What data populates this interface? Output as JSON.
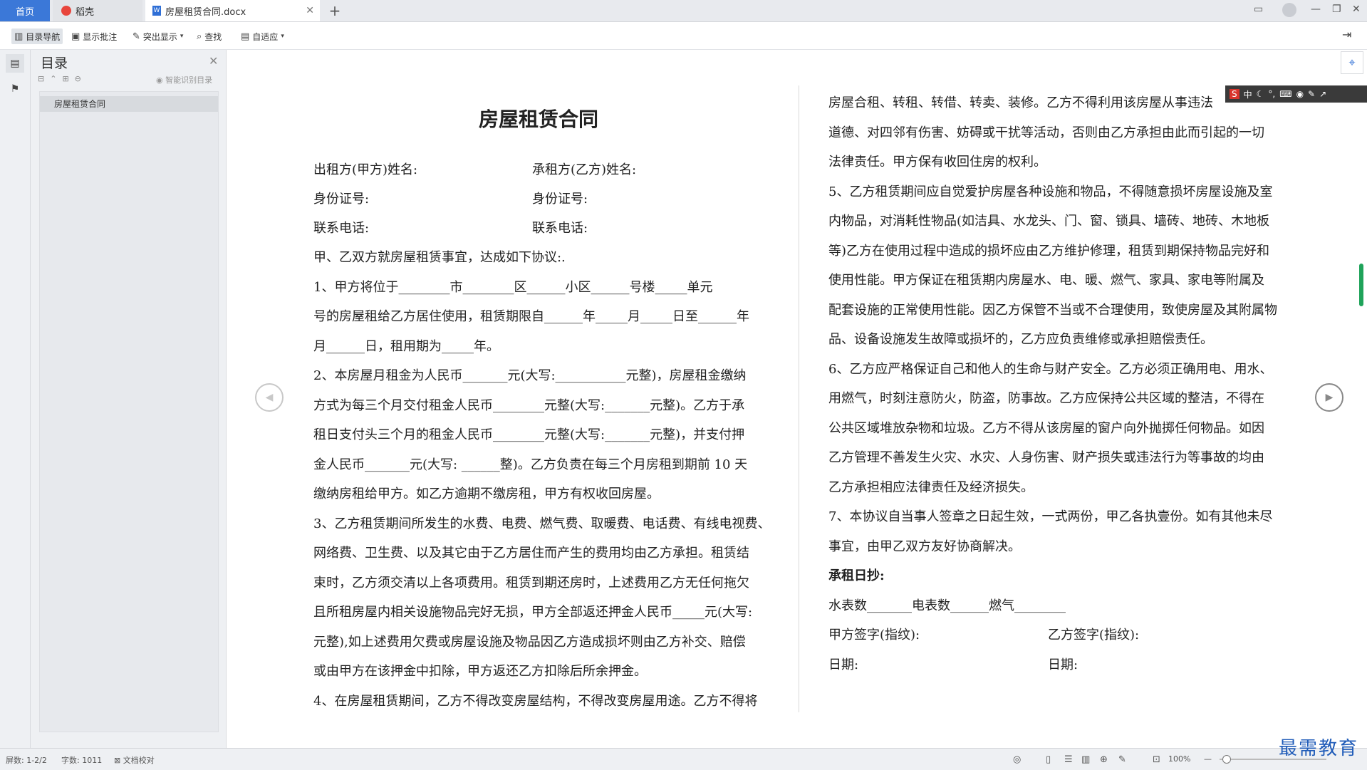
{
  "tabs": {
    "home": "首页",
    "daoke": "稻壳",
    "doc": "房屋租赁合同.docx"
  },
  "toolbar": {
    "toc_nav": "目录导航",
    "show_comments": "显示批注",
    "highlight": "突出显示",
    "find": "查找",
    "fit": "自适应"
  },
  "nav": {
    "title": "目录",
    "smart_toc": "智能识别目录",
    "items": [
      "房屋租赁合同"
    ]
  },
  "document": {
    "title": "房屋租赁合同",
    "left_lines": [
      "出租方(甲方)姓名:",
      "承租方(乙方)姓名:",
      "身份证号:",
      "身份证号:",
      "联系电话:",
      "联系电话:",
      "甲、乙双方就房屋租赁事宜，达成如下协议:.",
      "1、甲方将位于________市________区______小区______号楼_____单元",
      "号的房屋租给乙方居住使用，租赁期限自______年_____月_____日至______年",
      "月______日，租用期为_____年。",
      "2、本房屋月租金为人民币_______元(大写:___________元整)，房屋租金缴纳",
      "方式为每三个月交付租金人民币________元整(大写:_______元整)。乙方于承",
      "租日支付头三个月的租金人民币________元整(大写:_______元整)，并支付押",
      "金人民币_______元(大写: ______整)。乙方负责在每三个月房租到期前 10 天",
      "缴纳房租给甲方。如乙方逾期不缴房租，甲方有权收回房屋。",
      "3、乙方租赁期间所发生的水费、电费、燃气费、取暖费、电话费、有线电视费、",
      "网络费、卫生费、以及其它由于乙方居住而产生的费用均由乙方承担。租赁结",
      "束时，乙方须交清以上各项费用。租赁到期还房时，上述费用乙方无任何拖欠",
      "且所租房屋内相关设施物品完好无损，甲方全部返还押金人民币_____元(大写:",
      "元整),如上述费用欠费或房屋设施及物品因乙方造成损坏则由乙方补交、赔偿",
      "或由甲方在该押金中扣除，甲方返还乙方扣除后所余押金。",
      "4、在房屋租赁期间，乙方不得改变房屋结构，不得改变房屋用途。乙方不得将"
    ],
    "right_lines": [
      "房屋合租、转租、转借、转卖、装修。乙方不得利用该房屋从事违法",
      "道德、对四邻有伤害、妨碍或干扰等活动，否则由乙方承担由此而引起的一切",
      "法律责任。甲方保有收回住房的权利。",
      "5、乙方租赁期间应自觉爱护房屋各种设施和物品，不得随意损坏房屋设施及室",
      "内物品，对消耗性物品(如洁具、水龙头、门、窗、锁具、墙砖、地砖、木地板",
      "等)乙方在使用过程中造成的损坏应由乙方维护修理，租赁到期保持物品完好和",
      "使用性能。甲方保证在租赁期内房屋水、电、暖、燃气、家具、家电等附属及",
      "配套设施的正常使用性能。因乙方保管不当或不合理使用，致使房屋及其附属物",
      "品、设备设施发生故障或损坏的，乙方应负责维修或承担赔偿责任。",
      "6、乙方应严格保证自己和他人的生命与财产安全。乙方必须正确用电、用水、",
      "用燃气，时刻注意防火，防盗，防事故。乙方应保持公共区域的整洁，不得在",
      "公共区域堆放杂物和垃圾。乙方不得从该房屋的窗户向外抛掷任何物品。如因",
      "乙方管理不善发生火灾、水灾、人身伤害、财产损失或违法行为等事故的均由",
      "乙方承担相应法律责任及经济损失。",
      "7、本协议自当事人签章之日起生效，一式两份，甲乙各执壹份。如有其他未尽",
      "事宜，由甲乙双方友好协商解决。",
      "承租日抄:",
      "水表数_______电表数______燃气________",
      "甲方签字(指纹):",
      "乙方签字(指纹):",
      "日期:",
      "日期:"
    ]
  },
  "ime": {
    "label": "中"
  },
  "status": {
    "pages": "屏数: 1-2/2",
    "words": "字数: 1011",
    "proof": "文档校对",
    "zoom": "100%"
  },
  "watermark": "最需教育"
}
